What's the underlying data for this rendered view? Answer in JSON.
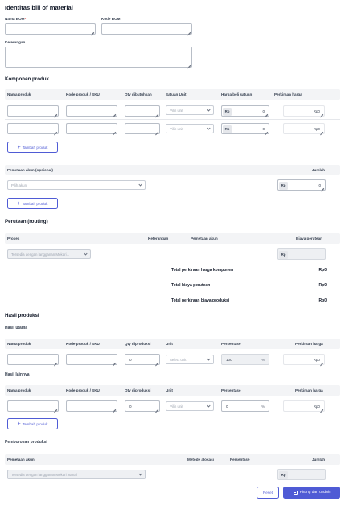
{
  "identitas": {
    "title": "Identitas bill of material",
    "nama_bom_label": "Nama BOM",
    "required_mark": "*",
    "kode_bom_label": "Kode BOM",
    "keterangan_label": "Keterangan"
  },
  "komponen": {
    "title": "Komponen produk",
    "headers": [
      "Nama produk",
      "Kode produk / SKU",
      "Qty dibutuhkan",
      "Satuan Unit",
      "Harga beli satuan",
      "Perkiraan harga"
    ],
    "rows": [
      {
        "unit_placeholder": "Pilih unit",
        "currency": "Rp",
        "price": "0",
        "estimate": "Rp0"
      },
      {
        "unit_placeholder": "Pilih unit",
        "currency": "Rp",
        "price": "0",
        "estimate": "Rp0"
      }
    ],
    "add_button": "Tambah produk"
  },
  "pemetaan": {
    "header_account": "Pemetaan akun (opsional)",
    "header_amount": "Jumlah",
    "account_placeholder": "Pilih akun",
    "currency": "Rp",
    "amount": "0",
    "add_button": "Tambah produk"
  },
  "perutean": {
    "title": "Perutean (routing)",
    "headers": [
      "Proses",
      "Keterangan",
      "Pemetaan akun",
      "Biaya perutean"
    ],
    "process_placeholder": "Tersedia dengan langganan Mekari...",
    "currency": "Rp"
  },
  "totals": [
    {
      "label": "Total perkiraan harga komponen",
      "value": "Rp0"
    },
    {
      "label": "Total biaya perutean",
      "value": "Rp0"
    },
    {
      "label": "Total perkiraan biaya produksi",
      "value": "Rp0"
    }
  ],
  "hasil": {
    "title": "Hasil produksi",
    "utama_title": "Hasil utama",
    "utama_headers": [
      "Nama produk",
      "Kode produk / SKU",
      "Qty diproduksi",
      "Unit",
      "Persentase",
      "Perkiraan harga"
    ],
    "utama_row": {
      "qty": "0",
      "unit_placeholder": "Select unit",
      "percent": "100",
      "percent_sign": "%",
      "estimate": "Rp0"
    },
    "lainnya_title": "Hasil lainnya",
    "lainnya_headers": [
      "Nama produk",
      "Kode produk / SKU",
      "Qty diproduksi",
      "Unit",
      "Persentase",
      "Perkiraan harga"
    ],
    "lainnya_row": {
      "qty": "0",
      "unit_placeholder": "Pilih unit",
      "percent": "0",
      "percent_sign": "%",
      "estimate": "Rp0"
    },
    "add_button": "Tambah produk"
  },
  "pemborosan": {
    "title": "Pemborosan produksi",
    "headers": [
      "Pemetaan akun",
      "Metode alokasi",
      "Persentase",
      "Jumlah"
    ],
    "account_placeholder": "Tersedia dengan langganan Mekari Jurnal",
    "currency": "Rp"
  },
  "actions": {
    "reset": "Reset",
    "submit": "Hitung dan unduh"
  },
  "colors": {
    "primary": "#4f5bd5",
    "header_bg": "#f3f4f6",
    "disabled_bg": "#eef0f3"
  }
}
